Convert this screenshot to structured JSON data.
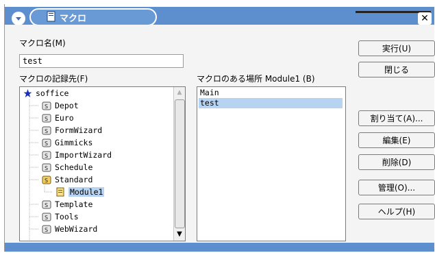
{
  "window": {
    "title": "マクロ"
  },
  "labels": {
    "macro_name": "マクロ名(M)",
    "save_in": "マクロの記録先(F)",
    "existing_macros": "マクロのある場所 Module1 (B)"
  },
  "macro_name_value": "test",
  "tree": {
    "root": "soffice",
    "items": [
      "Depot",
      "Euro",
      "FormWizard",
      "Gimmicks",
      "ImportWizard",
      "Schedule",
      "Standard",
      "Module1",
      "Template",
      "Tools",
      "WebWizard"
    ],
    "selected": "Module1"
  },
  "macros": {
    "items": [
      "Main",
      "test"
    ],
    "selected": "test"
  },
  "buttons": {
    "run": "実行(U)",
    "close": "閉じる",
    "assign": "割り当て(A)...",
    "edit": "編集(E)",
    "delete": "削除(D)",
    "organizer": "管理(O)...",
    "help": "ヘルプ(H)"
  },
  "colors": {
    "titlebar": "#5d8fcf",
    "selection": "#b7d3f2"
  }
}
